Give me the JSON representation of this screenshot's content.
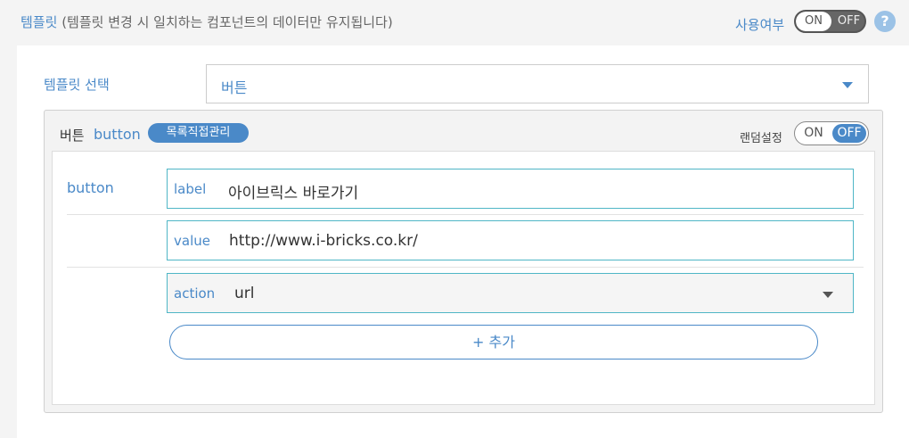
{
  "header": {
    "title": "템플릿",
    "description": "(템플릿 변경 시 일치하는 컴포넌트의 데이터만 유지됩니다)",
    "use_label": "사용여부",
    "toggle_on": "ON",
    "toggle_off": "OFF",
    "help_icon_glyph": "?"
  },
  "template_select": {
    "label": "템플릿 선택",
    "value": "버튼"
  },
  "component": {
    "title": "버튼",
    "title_en": "button",
    "badge": "목록직접관리",
    "random_label": "랜덤설정",
    "random_toggle": {
      "on": "ON",
      "off": "OFF",
      "state": "OFF"
    },
    "section_label": "button",
    "fields": {
      "label": {
        "key": "label",
        "value": "아이브릭스 바로가기"
      },
      "value": {
        "key": "value",
        "value": "http://www.i-bricks.co.kr/"
      },
      "action": {
        "key": "action",
        "value": "url"
      }
    },
    "add_button": "+ 추가"
  },
  "colors": {
    "accent": "#4a89c8",
    "field_border": "#4fb6c6"
  },
  "icons": [
    "help-icon",
    "chevron-down-icon"
  ]
}
